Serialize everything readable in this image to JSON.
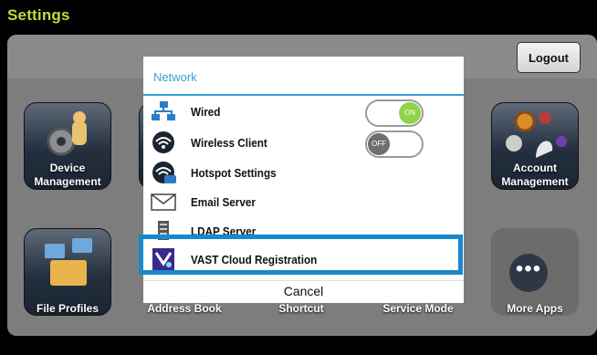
{
  "topbar": {
    "title": "Settings"
  },
  "header": {
    "logout_label": "Logout"
  },
  "tiles": {
    "device": "Device\nManagement",
    "account": "Account\nManagement",
    "file_profiles": "File Profiles",
    "address_book": "Address Book",
    "shortcut": "Shortcut",
    "service_mode": "Service Mode",
    "more_apps": "More Apps",
    "more_dots": "•••"
  },
  "dialog": {
    "title": "Network",
    "items": [
      {
        "label": "Wired",
        "icon": "network-icon",
        "toggle": "ON"
      },
      {
        "label": "Wireless Client",
        "icon": "wifi-icon",
        "toggle": "OFF"
      },
      {
        "label": "Hotspot Settings",
        "icon": "hotspot-icon"
      },
      {
        "label": "Email Server",
        "icon": "envelope-icon"
      },
      {
        "label": "LDAP Server",
        "icon": "server-icon"
      },
      {
        "label": "VAST Cloud Registration",
        "icon": "vast-cloud-icon"
      }
    ],
    "cancel_label": "Cancel"
  },
  "colors": {
    "accent": "#31a3d6",
    "highlight": "#1a88cb",
    "toggle_on": "#8fd449",
    "title": "#c8d63c"
  }
}
